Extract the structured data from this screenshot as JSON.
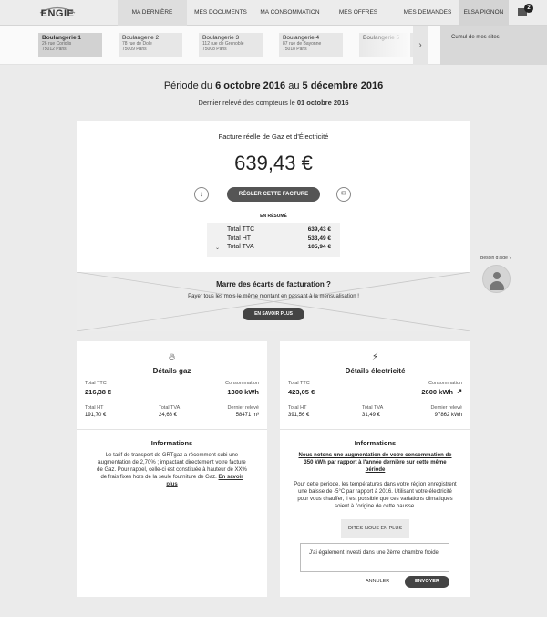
{
  "brand": {
    "logo_text": "ENGIE"
  },
  "nav": {
    "items": [
      {
        "label": "MA DERNIÈRE FACTURE"
      },
      {
        "label": "MES DOCUMENTS"
      },
      {
        "label": "MA CONSOMMATION"
      },
      {
        "label": "MES OFFRES"
      },
      {
        "label": "MES DEMANDES"
      }
    ],
    "user": "ELSA PIGNON",
    "mail_badge": "2"
  },
  "sites": {
    "items": [
      {
        "name": "Boulangerie 1",
        "addr1": "26 rue Coriolis",
        "addr2": "75012 Paris"
      },
      {
        "name": "Boulangerie 2",
        "addr1": "78 rue de Dole",
        "addr2": "75009 Paris"
      },
      {
        "name": "Boulangerie 3",
        "addr1": "112 rue de Grenoble",
        "addr2": "75008 Paris"
      },
      {
        "name": "Boulangerie 4",
        "addr1": "87 rue de Bayonne",
        "addr2": "75018 Paris"
      },
      {
        "name": "Boulangerie 5",
        "addr1": "",
        "addr2": ""
      }
    ],
    "cumul": "Cumul de mes sites"
  },
  "period": {
    "prefix": "Période du",
    "start": "6 octobre 2016",
    "middle": "au",
    "end": "5 décembre 2016",
    "last_read_prefix": "Dernier relevé des compteurs le",
    "last_read_date": "01 octobre 2016"
  },
  "invoice": {
    "title": "Facture réelle de Gaz et d'Électricité",
    "amount": "639,43 €",
    "pay_button": "RÉGLER CETTE FACTURE",
    "summary_label": "EN RÉSUMÉ",
    "summary": [
      {
        "label": "Total TTC",
        "value": "639,43 €"
      },
      {
        "label": "Total HT",
        "value": "533,49 €"
      },
      {
        "label": "Total TVA",
        "value": "105,94 €"
      }
    ]
  },
  "promo": {
    "title": "Marre des écarts de facturation ?",
    "text": "Payer tous les mois le même montant en passant à la mensualisation !",
    "button": "EN SAVOIR PLUS"
  },
  "help": {
    "label": "Besoin d'aide ?"
  },
  "gas": {
    "title": "Détails gaz",
    "ttc_label": "Total TTC",
    "ttc": "216,38 €",
    "conso_label": "Consommation",
    "conso": "1300 kWh",
    "ht_label": "Total HT",
    "ht": "191,70 €",
    "tva_label": "Total TVA",
    "tva": "24,68 €",
    "releve_label": "Dernier relevé",
    "releve": "58471 m³",
    "info_title": "Informations",
    "info_text": "Le tarif de transport de GRTgaz a récemment subi une augmentation de 2,70% ; impactant directement votre facture de Gaz. Pour rappel, celle-ci est constituée à hauteur de XX% de frais fixes hors de la seule fourniture de Gaz.",
    "info_link": "En savoir plus"
  },
  "elec": {
    "title": "Détails électricité",
    "ttc_label": "Total TTC",
    "ttc": "423,05 €",
    "conso_label": "Consommation",
    "conso": "2600 kWh",
    "ht_label": "Total HT",
    "ht": "391,56 €",
    "tva_label": "Total TVA",
    "tva": "31,49 €",
    "releve_label": "Dernier relevé",
    "releve": "97862 kWh",
    "info_title": "Informations",
    "info_highlight": "Nous notons une augmentation de votre consommation de 350 kWh par rapport à l'année dernière sur cette même période",
    "info_text": "Pour cette période, les températures dans votre région enregistrent une baisse de -5°C par rapport à 2016. Utilisant votre électricité pour vous chauffer, il est possible que ces variations climatiques soient à l'origine de cette hausse.",
    "tell_button": "DITES-NOUS EN PLUS",
    "feedback_value": "J'ai également investi dans une 2ème chambre froide",
    "cancel": "ANNULER",
    "send": "ENVOYER"
  }
}
